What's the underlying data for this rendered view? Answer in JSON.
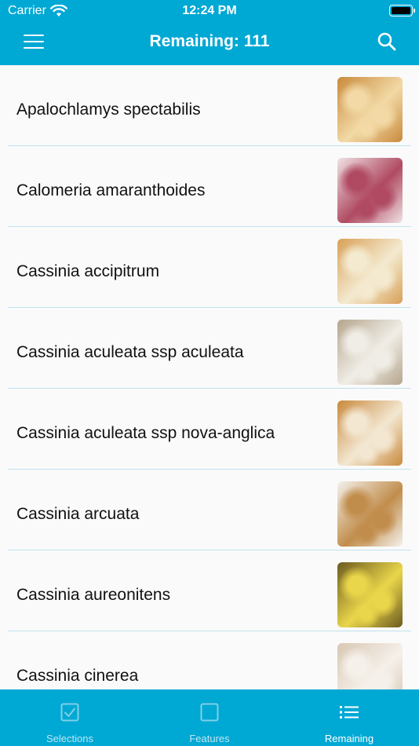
{
  "status_bar": {
    "carrier": "Carrier",
    "time": "12:24 PM"
  },
  "nav": {
    "title": "Remaining: 111"
  },
  "list": {
    "items": [
      {
        "label": "Apalochlamys spectabilis",
        "thumb": {
          "bg": "#c98a3c",
          "accent": "#f2d9a5"
        }
      },
      {
        "label": "Calomeria amaranthoides",
        "thumb": {
          "bg": "#efe2e4",
          "accent": "#b04a62"
        }
      },
      {
        "label": "Cassinia accipitrum",
        "thumb": {
          "bg": "#d8a057",
          "accent": "#f4ead0"
        }
      },
      {
        "label": "Cassinia aculeata ssp aculeata",
        "thumb": {
          "bg": "#b5a58d",
          "accent": "#f0ede6"
        }
      },
      {
        "label": "Cassinia aculeata ssp nova-anglica",
        "thumb": {
          "bg": "#c98a3c",
          "accent": "#f3e7d2"
        }
      },
      {
        "label": "Cassinia arcuata",
        "thumb": {
          "bg": "#f4f1ec",
          "accent": "#c18d4c"
        }
      },
      {
        "label": "Cassinia aureonitens",
        "thumb": {
          "bg": "#6b5a20",
          "accent": "#ead64a"
        }
      },
      {
        "label": "Cassinia cinerea",
        "thumb": {
          "bg": "#d8c7b2",
          "accent": "#f5f0ea"
        }
      }
    ]
  },
  "tabbar": {
    "tabs": [
      {
        "label": "Selections",
        "icon": "checkbox-checked-icon"
      },
      {
        "label": "Features",
        "icon": "checkbox-empty-icon"
      },
      {
        "label": "Remaining",
        "icon": "list-icon"
      }
    ],
    "active_index": 2
  },
  "colors": {
    "accent": "#00a8d4",
    "separator": "#bfe3ee"
  }
}
